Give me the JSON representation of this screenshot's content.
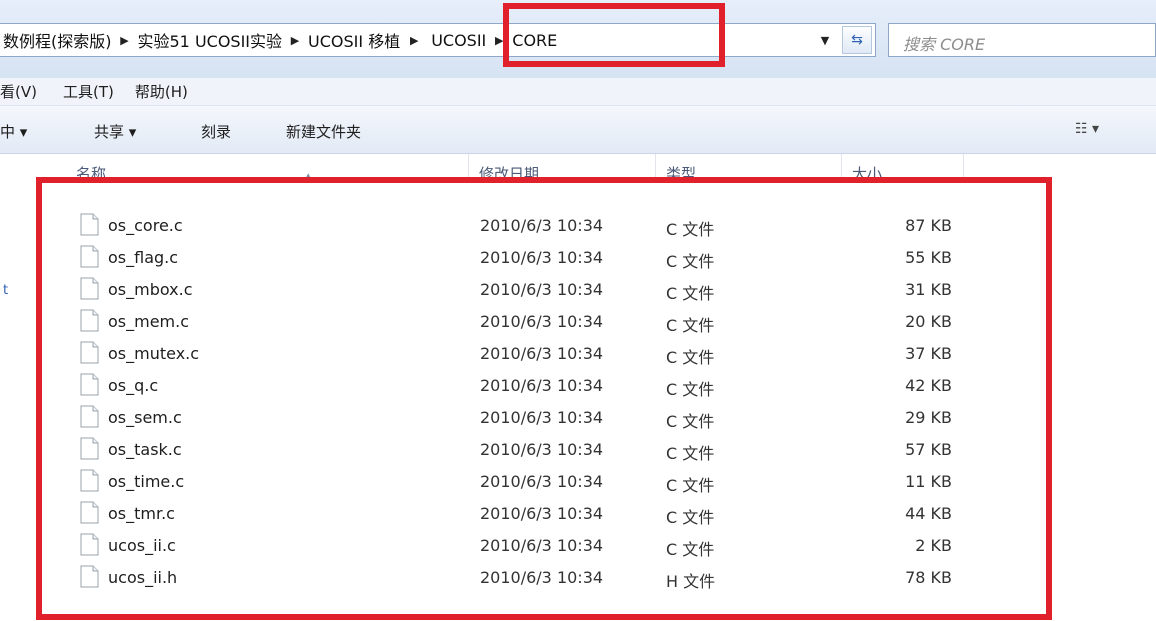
{
  "address": {
    "crumbs": [
      "数例程(探索版)",
      "实验51 UCOSII实验",
      "UCOSII 移植",
      "UCOSII",
      "CORE"
    ],
    "search_placeholder": "搜索 CORE",
    "dropdown_glyph": "▼",
    "refresh_glyph": "⇆"
  },
  "menu": [
    "看(V)",
    "工具(T)",
    "帮助(H)"
  ],
  "commands": {
    "include": "中 ▾",
    "share": "共享 ▾",
    "burn": "刻录",
    "new_folder": "新建文件夹",
    "view": "☷ ▾"
  },
  "columns": {
    "name": "名称",
    "date": "修改日期",
    "type": "类型",
    "size": "大小"
  },
  "files": [
    {
      "name": "os_core.c",
      "date": "2010/6/3 10:34",
      "type": "C 文件",
      "size": "87 KB"
    },
    {
      "name": "os_flag.c",
      "date": "2010/6/3 10:34",
      "type": "C 文件",
      "size": "55 KB"
    },
    {
      "name": "os_mbox.c",
      "date": "2010/6/3 10:34",
      "type": "C 文件",
      "size": "31 KB"
    },
    {
      "name": "os_mem.c",
      "date": "2010/6/3 10:34",
      "type": "C 文件",
      "size": "20 KB"
    },
    {
      "name": "os_mutex.c",
      "date": "2010/6/3 10:34",
      "type": "C 文件",
      "size": "37 KB"
    },
    {
      "name": "os_q.c",
      "date": "2010/6/3 10:34",
      "type": "C 文件",
      "size": "42 KB"
    },
    {
      "name": "os_sem.c",
      "date": "2010/6/3 10:34",
      "type": "C 文件",
      "size": "29 KB"
    },
    {
      "name": "os_task.c",
      "date": "2010/6/3 10:34",
      "type": "C 文件",
      "size": "57 KB"
    },
    {
      "name": "os_time.c",
      "date": "2010/6/3 10:34",
      "type": "C 文件",
      "size": "11 KB"
    },
    {
      "name": "os_tmr.c",
      "date": "2010/6/3 10:34",
      "type": "C 文件",
      "size": "44 KB"
    },
    {
      "name": "ucos_ii.c",
      "date": "2010/6/3 10:34",
      "type": "C 文件",
      "size": "2 KB"
    },
    {
      "name": "ucos_ii.h",
      "date": "2010/6/3 10:34",
      "type": "H 文件",
      "size": "78 KB"
    }
  ],
  "side_marker": "t",
  "highlight_color": "#e0202a"
}
